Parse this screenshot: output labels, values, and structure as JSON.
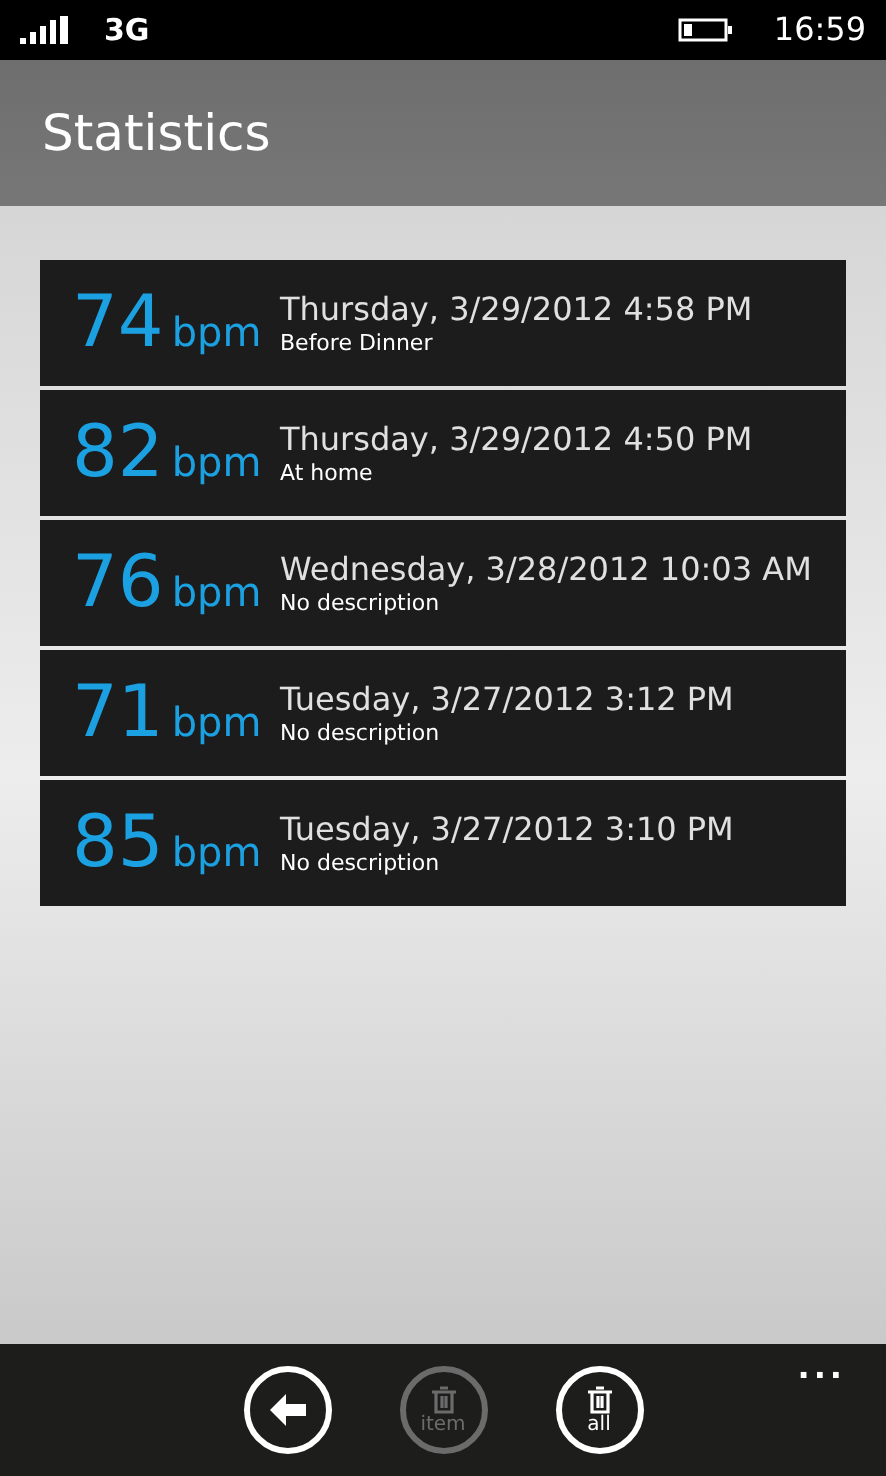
{
  "status_bar": {
    "network": "3G",
    "time": "16:59"
  },
  "header": {
    "title": "Statistics"
  },
  "readings": [
    {
      "value": "74",
      "unit": "bpm",
      "date": "Thursday, 3/29/2012 4:58 PM",
      "description": "Before Dinner"
    },
    {
      "value": "82",
      "unit": "bpm",
      "date": "Thursday, 3/29/2012 4:50 PM",
      "description": "At home"
    },
    {
      "value": "76",
      "unit": "bpm",
      "date": "Wednesday, 3/28/2012 10:03 AM",
      "description": "No description"
    },
    {
      "value": "71",
      "unit": "bpm",
      "date": "Tuesday, 3/27/2012 3:12 PM",
      "description": "No description"
    },
    {
      "value": "85",
      "unit": "bpm",
      "date": "Tuesday, 3/27/2012 3:10 PM",
      "description": "No description"
    }
  ],
  "app_bar": {
    "buttons": [
      {
        "kind": "back",
        "disabled": false
      },
      {
        "kind": "delete",
        "label": "item",
        "disabled": true
      },
      {
        "kind": "delete",
        "label": "all",
        "disabled": false
      }
    ],
    "more": "..."
  }
}
